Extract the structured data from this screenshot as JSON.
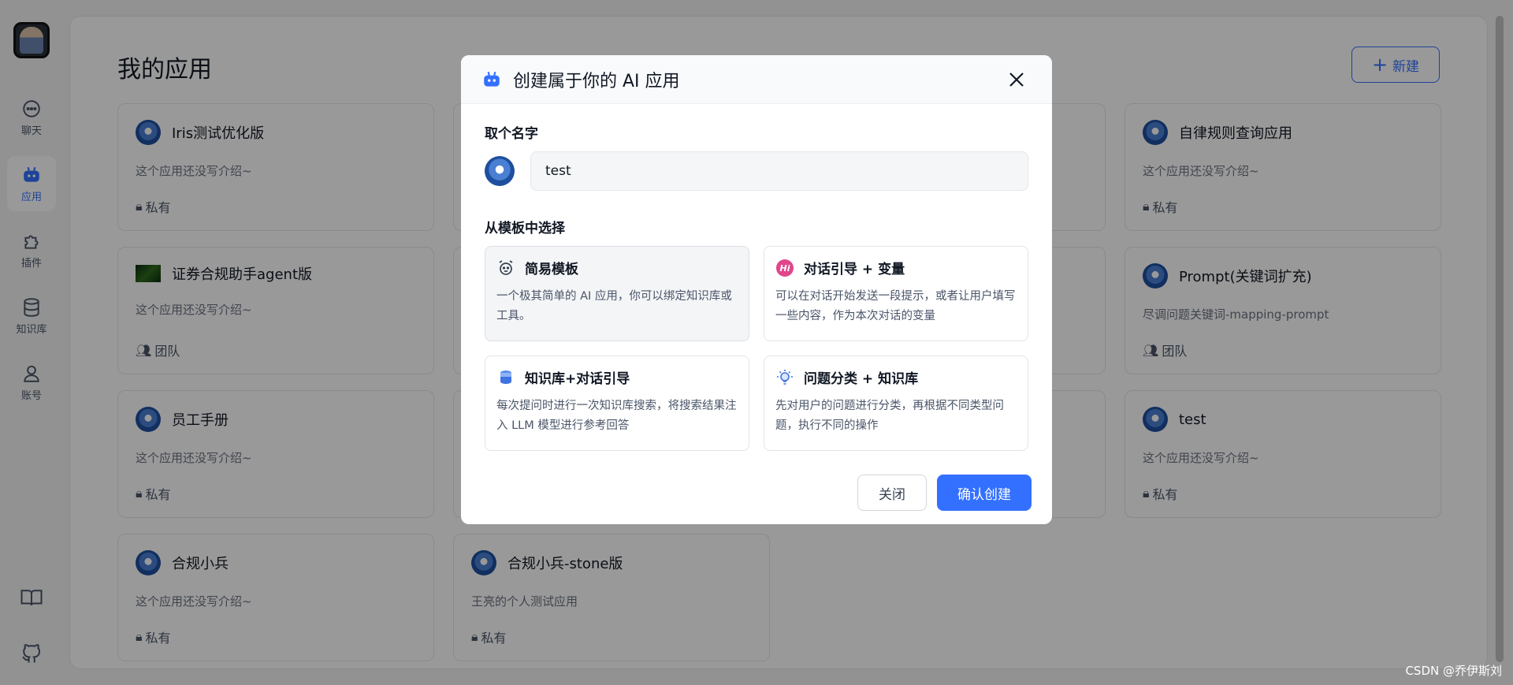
{
  "sidebar": {
    "items": [
      {
        "label": "聊天",
        "icon": "chat-icon"
      },
      {
        "label": "应用",
        "icon": "robot-icon"
      },
      {
        "label": "插件",
        "icon": "puzzle-icon"
      },
      {
        "label": "知识库",
        "icon": "database-icon"
      },
      {
        "label": "账号",
        "icon": "user-icon"
      }
    ],
    "bottom_icons": [
      "book-icon",
      "github-icon"
    ]
  },
  "main": {
    "title": "我的应用",
    "new_button": "新建",
    "cards": [
      {
        "title": "Iris测试优化版",
        "intro": "这个应用还没写介绍~",
        "tag": "私有"
      },
      {
        "title": "",
        "intro": "",
        "tag": ""
      },
      {
        "title": "",
        "intro": "",
        "tag": ""
      },
      {
        "title": "自律规则查询应用",
        "intro": "这个应用还没写介绍~",
        "tag": "私有"
      },
      {
        "title": "证券合规助手agent版",
        "intro": "这个应用还没写介绍~",
        "tag": "团队"
      },
      {
        "title": "",
        "intro": "",
        "tag": ""
      },
      {
        "title": "",
        "intro": "",
        "tag": ""
      },
      {
        "title": "Prompt(关键词扩充)",
        "intro": "尽调问题关键词-mapping-prompt",
        "tag": "团队"
      },
      {
        "title": "员工手册",
        "intro": "这个应用还没写介绍~",
        "tag": "私有"
      },
      {
        "title": "",
        "intro": "",
        "tag": ""
      },
      {
        "title": "",
        "intro": "",
        "tag": ""
      },
      {
        "title": "test",
        "intro": "这个应用还没写介绍~",
        "tag": "私有"
      },
      {
        "title": "合规小兵",
        "intro": "这个应用还没写介绍~",
        "tag": "私有"
      },
      {
        "title": "合规小兵-stone版",
        "intro": "王亮的个人测试应用",
        "tag": "私有"
      }
    ]
  },
  "modal": {
    "title": "创建属于你的 AI 应用",
    "name_label": "取个名字",
    "name_value": "test",
    "template_label": "从模板中选择",
    "templates": [
      {
        "title": "简易模板",
        "desc": "一个极其简单的 AI 应用，你可以绑定知识库或工具。"
      },
      {
        "title": "对话引导 + 变量",
        "desc": "可以在对话开始发送一段提示，或者让用户填写一些内容，作为本次对话的变量"
      },
      {
        "title": "知识库+对话引导",
        "desc": "每次提问时进行一次知识库搜索，将搜索结果注入 LLM 模型进行参考回答"
      },
      {
        "title": "问题分类 + 知识库",
        "desc": "先对用户的问题进行分类，再根据不同类型问题，执行不同的操作"
      }
    ],
    "close_button": "关闭",
    "confirm_button": "确认创建"
  },
  "watermark": "CSDN @乔伊斯刘",
  "colors": {
    "accent": "#3370ff",
    "overlay": "rgba(0,0,0,0.4)"
  }
}
